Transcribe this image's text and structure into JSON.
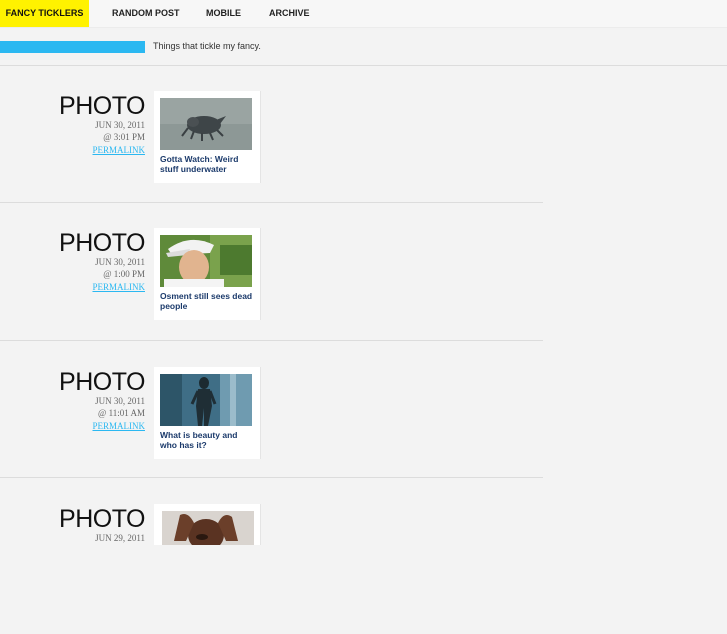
{
  "nav": {
    "brand": "FANCY TICKLERS",
    "items": [
      "RANDOM POST",
      "MOBILE",
      "ARCHIVE"
    ]
  },
  "tagline": "Things that tickle my fancy.",
  "posts": [
    {
      "type": "PHOTO",
      "date": "JUN 30, 2011",
      "time": "@ 3:01 PM",
      "link": "PERMALINK",
      "caption": "Gotta Watch: Weird stuff underwater",
      "thumb": "sea-creature-photo"
    },
    {
      "type": "PHOTO",
      "date": "JUN 30, 2011",
      "time": "@ 1:00 PM",
      "link": "PERMALINK",
      "caption": "Osment still sees dead people",
      "thumb": "golfer-portrait-photo"
    },
    {
      "type": "PHOTO",
      "date": "JUN 30, 2011",
      "time": "@ 11:01 AM",
      "link": "PERMALINK",
      "caption": "What is beauty and who has it?",
      "thumb": "statue-photo"
    },
    {
      "type": "PHOTO",
      "date": "JUN 29, 2011",
      "time": "",
      "link": "",
      "caption": "",
      "thumb": "woman-portrait-photo"
    }
  ],
  "colors": {
    "accent_yellow": "#fff200",
    "accent_blue": "#2bb8f1",
    "caption_blue": "#1b3a6b"
  }
}
